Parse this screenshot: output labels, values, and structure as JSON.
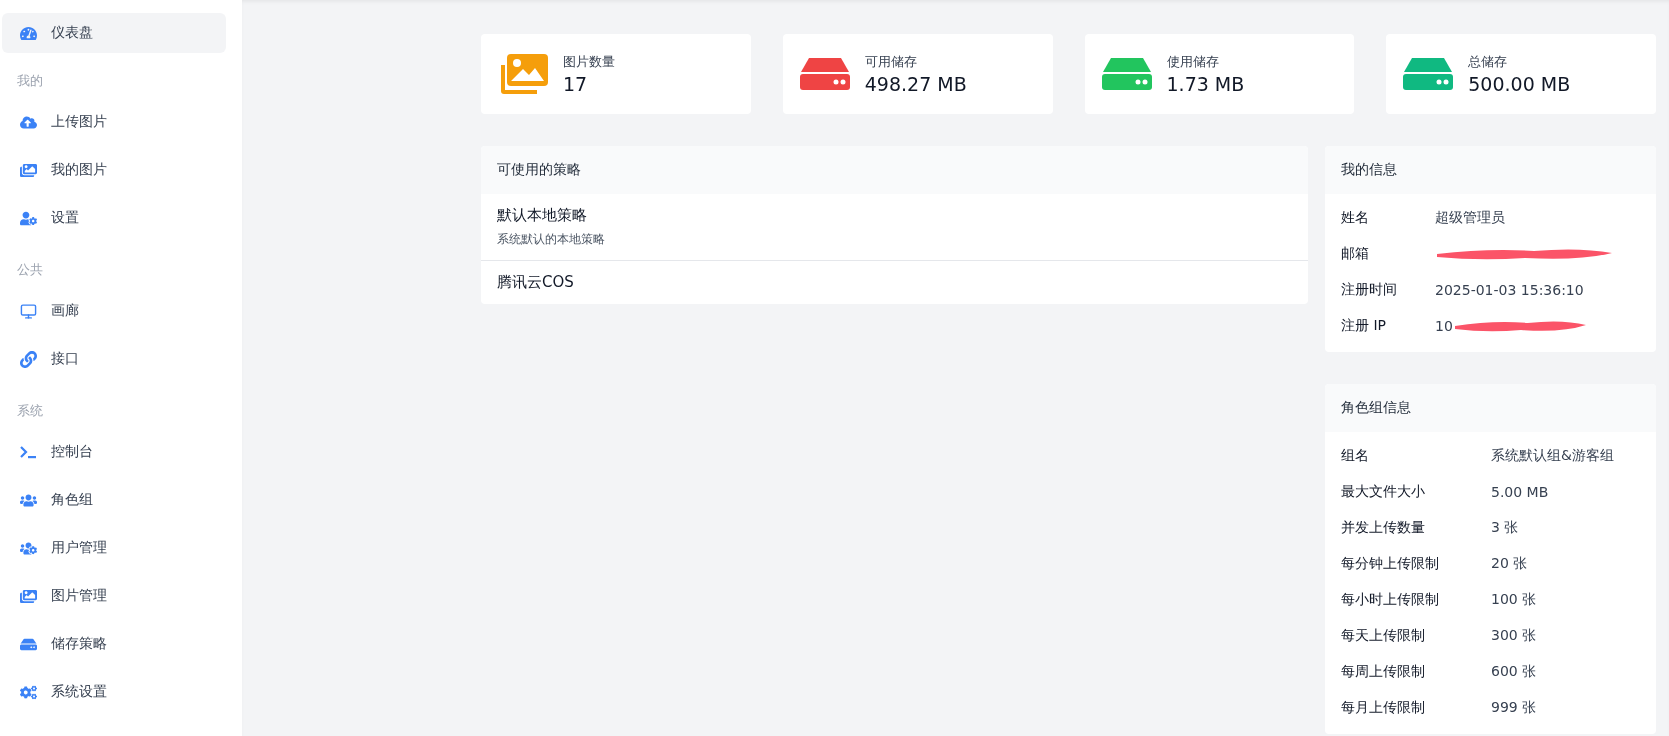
{
  "sidebar": {
    "items": [
      {
        "label": "仪表盘",
        "selected": true
      }
    ],
    "sections": [
      {
        "heading": "我的",
        "items": [
          {
            "label": "上传图片",
            "selected": false
          },
          {
            "label": "我的图片",
            "selected": false
          },
          {
            "label": "设置",
            "selected": false
          }
        ]
      },
      {
        "heading": "公共",
        "items": [
          {
            "label": "画廊",
            "selected": false
          },
          {
            "label": "接口",
            "selected": false
          }
        ]
      },
      {
        "heading": "系统",
        "items": [
          {
            "label": "控制台",
            "selected": false
          },
          {
            "label": "角色组",
            "selected": false
          },
          {
            "label": "用户管理",
            "selected": false
          },
          {
            "label": "图片管理",
            "selected": false
          },
          {
            "label": "储存策略",
            "selected": false
          },
          {
            "label": "系统设置",
            "selected": false
          }
        ]
      }
    ]
  },
  "stats": [
    {
      "kind": "images",
      "label": "图片数量",
      "value": "17",
      "color": "#f59e0b"
    },
    {
      "kind": "storage",
      "label": "可用储存",
      "value": "498.27 MB",
      "color": "#ef4444"
    },
    {
      "kind": "storage",
      "label": "使用储存",
      "value": "1.73 MB",
      "color": "#22c55e"
    },
    {
      "kind": "storage",
      "label": "总储存",
      "value": "500.00 MB",
      "color": "#10b981"
    }
  ],
  "policies": {
    "title": "可使用的策略",
    "items": [
      {
        "name": "默认本地策略",
        "description": "系统默认的本地策略"
      },
      {
        "name": "腾讯云COS"
      }
    ]
  },
  "my_info": {
    "title": "我的信息",
    "rows": [
      {
        "label": "姓名",
        "value": "超级管理员",
        "redacted": false
      },
      {
        "label": "邮箱",
        "redacted": true
      },
      {
        "label": "注册时间",
        "value": "2025-01-03 15:36:10",
        "redacted": false
      },
      {
        "label": "注册 IP",
        "value": "10",
        "redacted": true
      }
    ]
  },
  "role_info": {
    "title": "角色组信息",
    "rows": [
      {
        "label": "组名",
        "value": "系统默认组&游客组"
      },
      {
        "label": "最大文件大小",
        "value": "5.00 MB"
      },
      {
        "label": "并发上传数量",
        "value": "3 张"
      },
      {
        "label": "每分钟上传限制",
        "value": "20 张"
      },
      {
        "label": "每小时上传限制",
        "value": "100 张"
      },
      {
        "label": "每天上传限制",
        "value": "300 张"
      },
      {
        "label": "每周上传限制",
        "value": "600 张"
      },
      {
        "label": "每月上传限制",
        "value": "999 张"
      }
    ]
  }
}
